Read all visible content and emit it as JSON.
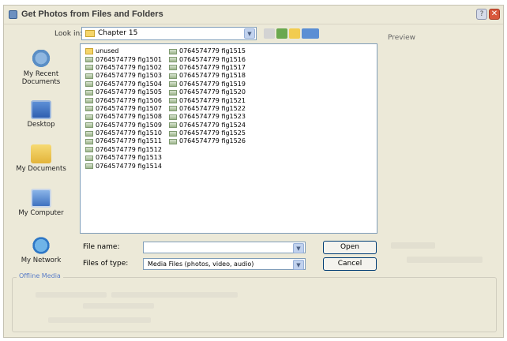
{
  "window": {
    "title": "Get Photos from Files and Folders"
  },
  "lookin": {
    "label": "Look in:",
    "value": "Chapter 15"
  },
  "preview": {
    "label": "Preview"
  },
  "places": [
    {
      "label": "My Recent Documents"
    },
    {
      "label": "Desktop"
    },
    {
      "label": "My Documents"
    },
    {
      "label": "My Computer"
    },
    {
      "label": "My Network"
    }
  ],
  "files_col1": [
    "unused",
    "0764574779 fig1501",
    "0764574779 fig1502",
    "0764574779 fig1503",
    "0764574779 fig1504",
    "0764574779 fig1505",
    "0764574779 fig1506",
    "0764574779 fig1507",
    "0764574779 fig1508",
    "0764574779 fig1509",
    "0764574779 fig1510",
    "0764574779 fig1511",
    "0764574779 fig1512",
    "0764574779 fig1513",
    "0764574779 fig1514"
  ],
  "files_col2": [
    "0764574779 fig1515",
    "0764574779 fig1516",
    "0764574779 fig1517",
    "0764574779 fig1518",
    "0764574779 fig1519",
    "0764574779 fig1520",
    "0764574779 fig1521",
    "0764574779 fig1522",
    "0764574779 fig1523",
    "0764574779 fig1524",
    "0764574779 fig1525",
    "0764574779 fig1526"
  ],
  "filename": {
    "label": "File name:",
    "value": ""
  },
  "filetype": {
    "label": "Files of type:",
    "value": "Media Files (photos, video, audio)"
  },
  "buttons": {
    "open": "Open",
    "cancel": "Cancel"
  },
  "offline": {
    "label": "Offline Media"
  }
}
